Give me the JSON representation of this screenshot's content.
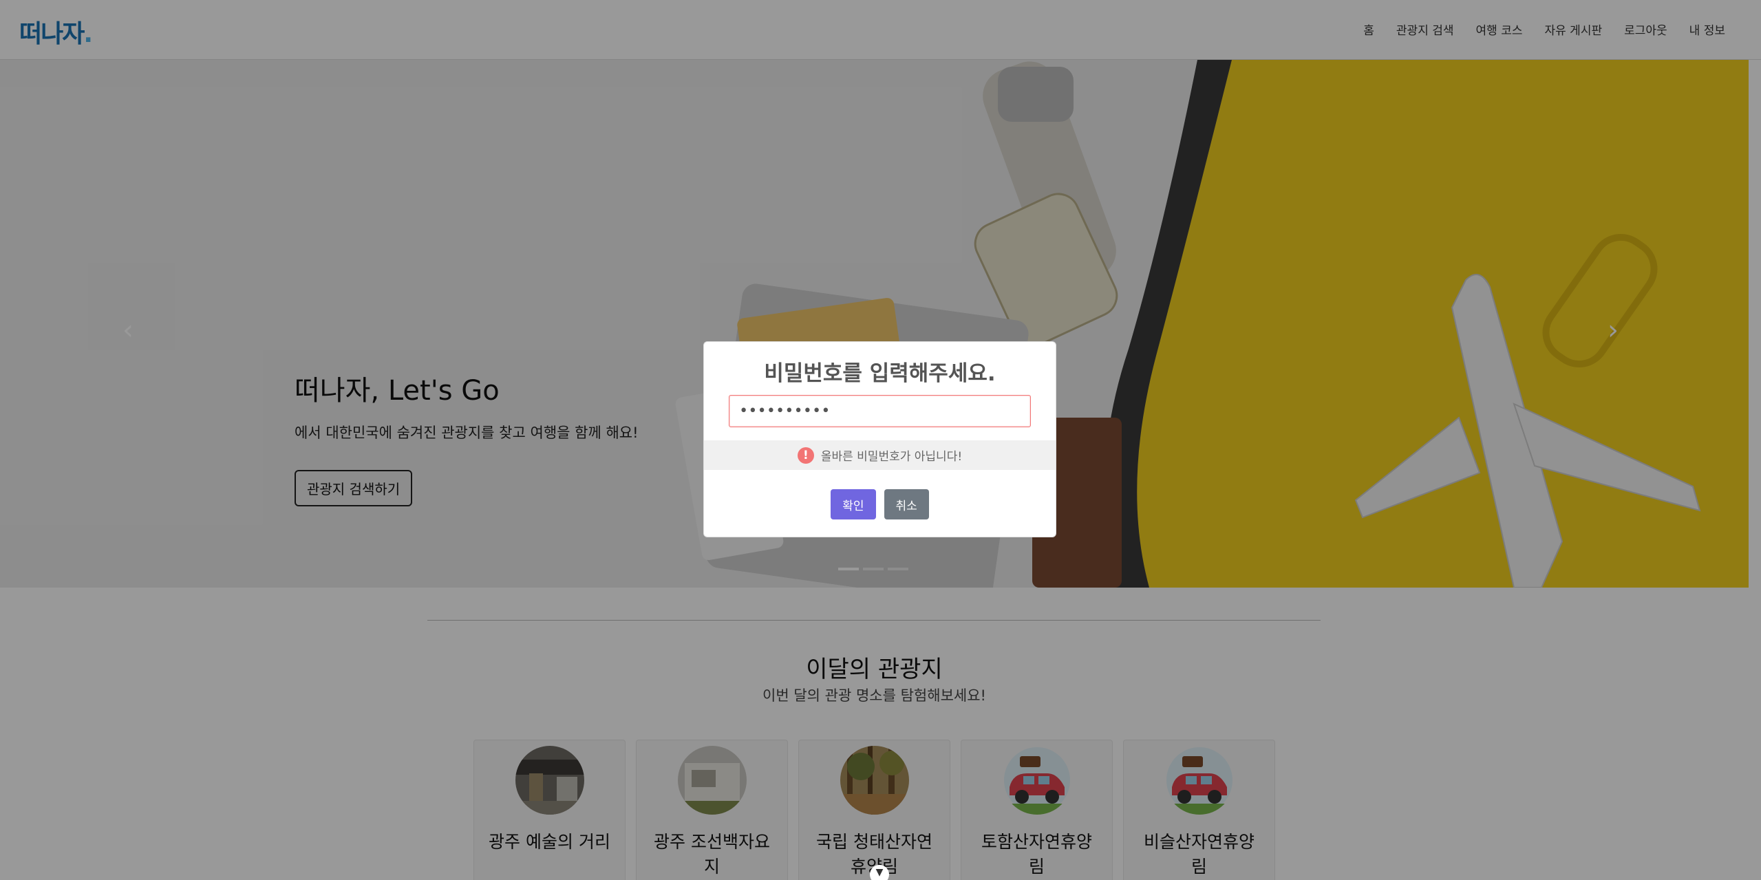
{
  "navbar": {
    "logo": "떠나자",
    "logo_dot": ".",
    "links": [
      "홈",
      "관광지 검색",
      "여행 코스",
      "자유 게시판",
      "로그아웃",
      "내 정보"
    ]
  },
  "hero": {
    "title": "떠나자, Let's Go",
    "subtitle": "에서 대한민국에 숨겨진 관광지를 찾고 여행을 함께 해요!",
    "button": "관광지 검색하기",
    "prev_arrow": "‹",
    "next_arrow": "›",
    "slide_count": 3,
    "active_slide": 1
  },
  "section": {
    "title": "이달의 관광지",
    "subtitle": "이번 달의 관광 명소를 탐험해보세요!"
  },
  "cards": [
    {
      "title": "광주 예술의 거리",
      "icon": "street-photo"
    },
    {
      "title": "광주 조선백자요지",
      "icon": "kiln-photo"
    },
    {
      "title": "국립 청태산자연휴양림",
      "icon": "forest-photo"
    },
    {
      "title": "토함산자연휴양림",
      "icon": "car-travel-icon"
    },
    {
      "title": "비슬산자연휴양림",
      "icon": "car-travel-icon"
    }
  ],
  "modal": {
    "title": "비밀번호를 입력해주세요.",
    "password_value": "••••••••••",
    "validation_icon": "!",
    "validation_message": "올바른 비밀번호가 아닙니다!",
    "confirm_label": "확인",
    "cancel_label": "취소"
  },
  "scroll_icon": "▼",
  "colors": {
    "accent": "#7066e0",
    "cancel": "#6e7881",
    "error": "#f27474",
    "logo": "#1a73b5"
  }
}
